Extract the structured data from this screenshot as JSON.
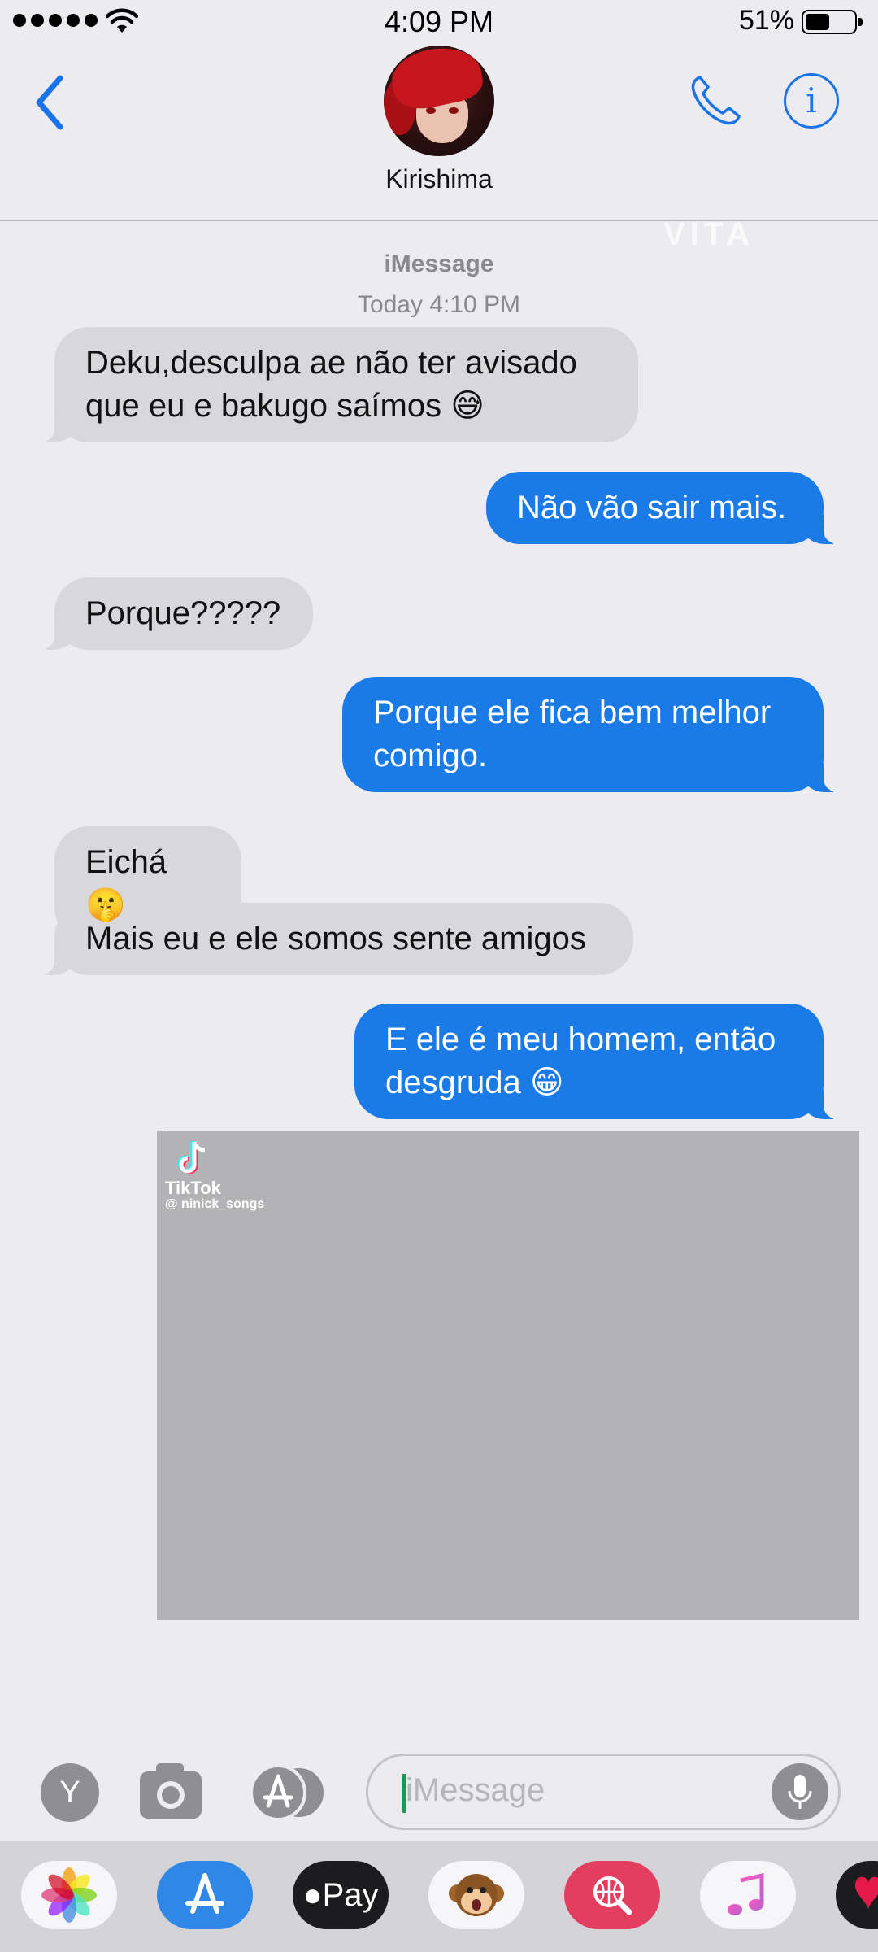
{
  "status_bar": {
    "time": "4:09 PM",
    "battery_percent": "51%",
    "battery_level": 0.51,
    "signal_dots": 5,
    "icons": [
      "signal-dots-icon",
      "wifi-icon",
      "battery-icon"
    ]
  },
  "header": {
    "contact_name": "Kirishima",
    "back_icon": "chevron-left-icon",
    "call_icon": "phone-icon",
    "info_label": "i"
  },
  "watermark": "VITA",
  "conversation": {
    "service": "iMessage",
    "timestamp": "Today 4:10 PM",
    "messages": [
      {
        "direction": "in",
        "text": "Deku,desculpa ae não ter avisado que eu e bakugo saímos 😅"
      },
      {
        "direction": "out",
        "text": "Não vão sair mais."
      },
      {
        "direction": "in",
        "text": "Porque?????"
      },
      {
        "direction": "out",
        "text": "Porque ele fica bem melhor comigo."
      },
      {
        "direction": "in",
        "text": "Eichá 🤫"
      },
      {
        "direction": "in",
        "text": "Mais eu e ele somos sente amigos"
      },
      {
        "direction": "out",
        "text": "E ele é meu homem, então desgruda 😁"
      }
    ],
    "attachment": {
      "brand": "TikTok",
      "username": "@ ninick_songs"
    }
  },
  "input_bar": {
    "y_button_label": "Y",
    "placeholder": "iMessage",
    "icons": [
      "camera-icon",
      "app-store-icon",
      "microphone-icon"
    ]
  },
  "dock": {
    "apple_pay_label": "Pay",
    "apps": [
      "photos",
      "app-store",
      "apple-pay",
      "memoji",
      "web-search",
      "music",
      "digital-touch"
    ]
  },
  "colors": {
    "accent": "#1a73e8",
    "outgoing_bubble": "#1a7ae6",
    "incoming_bubble": "#d8d8dc",
    "background": "#ececf0"
  }
}
